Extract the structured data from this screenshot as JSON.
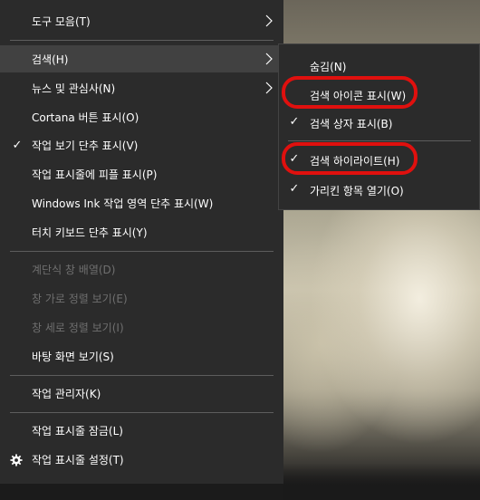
{
  "context_menu": {
    "items": [
      {
        "label": "도구 모음(T)",
        "has_submenu": true,
        "checked": false,
        "disabled": false
      },
      {
        "label": "검색(H)",
        "has_submenu": true,
        "checked": false,
        "disabled": false,
        "highlighted": true
      },
      {
        "label": "뉴스 및 관심사(N)",
        "has_submenu": true,
        "checked": false,
        "disabled": false
      },
      {
        "label": "Cortana 버튼 표시(O)",
        "has_submenu": false,
        "checked": false,
        "disabled": false
      },
      {
        "label": "작업 보기 단추 표시(V)",
        "has_submenu": false,
        "checked": true,
        "disabled": false
      },
      {
        "label": "작업 표시줄에 피플 표시(P)",
        "has_submenu": false,
        "checked": false,
        "disabled": false
      },
      {
        "label": "Windows Ink 작업 영역 단추 표시(W)",
        "has_submenu": false,
        "checked": false,
        "disabled": false
      },
      {
        "label": "터치 키보드 단추 표시(Y)",
        "has_submenu": false,
        "checked": false,
        "disabled": false
      },
      {
        "label": "계단식 창 배열(D)",
        "has_submenu": false,
        "checked": false,
        "disabled": true
      },
      {
        "label": "창 가로 정렬 보기(E)",
        "has_submenu": false,
        "checked": false,
        "disabled": true
      },
      {
        "label": "창 세로 정렬 보기(I)",
        "has_submenu": false,
        "checked": false,
        "disabled": true
      },
      {
        "label": "바탕 화면 보기(S)",
        "has_submenu": false,
        "checked": false,
        "disabled": false
      },
      {
        "label": "작업 관리자(K)",
        "has_submenu": false,
        "checked": false,
        "disabled": false
      },
      {
        "label": "작업 표시줄 잠금(L)",
        "has_submenu": false,
        "checked": false,
        "disabled": false
      },
      {
        "label": "작업 표시줄 설정(T)",
        "has_submenu": false,
        "checked": false,
        "disabled": false,
        "icon": "gear-icon"
      }
    ]
  },
  "search_submenu": {
    "items": [
      {
        "label": "숨김(N)",
        "checked": false,
        "annotated": false
      },
      {
        "label": "검색 아이콘 표시(W)",
        "checked": false,
        "annotated": true
      },
      {
        "label": "검색 상자 표시(B)",
        "checked": true,
        "annotated": false
      },
      {
        "label": "검색 하이라이트(H)",
        "checked": true,
        "annotated": true
      },
      {
        "label": "가리킨 항목 열기(O)",
        "checked": true,
        "annotated": false
      }
    ]
  },
  "colors": {
    "menu_bg": "#2b2b2b",
    "hover_bg": "#414141",
    "text": "#ffffff",
    "disabled_text": "#6f6f6f",
    "annotation": "#e0100e"
  }
}
